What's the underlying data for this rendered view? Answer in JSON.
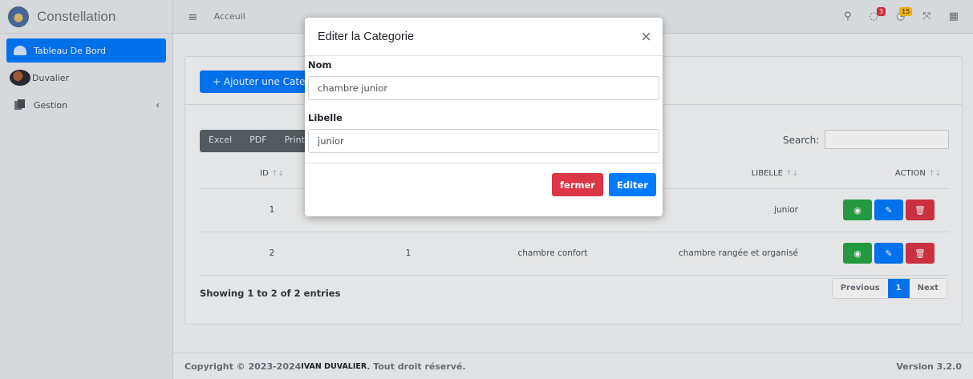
{
  "brand": {
    "name": "Constellation"
  },
  "sidebar": {
    "items": [
      {
        "label": "Tableau De Bord"
      },
      {
        "label": "Duvalier"
      },
      {
        "label": "Gestion"
      }
    ]
  },
  "topbar": {
    "link": "Acceuil",
    "messages_count": "3",
    "notifications_count": "15"
  },
  "content": {
    "add_button": "+ Ajouter une Categorie",
    "tools": [
      "Excel",
      "PDF",
      "Print"
    ],
    "search_label": "Search:",
    "columns": [
      "ID",
      "",
      "",
      "LIBELLE",
      "ACTION"
    ],
    "rows": [
      {
        "id": "1",
        "c2": "",
        "c3": "",
        "libelle": "junior"
      },
      {
        "id": "2",
        "c2": "1",
        "c3": "chambre confort",
        "libelle": "chambre rangée et organisé"
      }
    ],
    "showing": "Showing 1 to 2 of 2 entries",
    "pager": {
      "prev": "Previous",
      "page": "1",
      "next": "Next"
    }
  },
  "footer": {
    "copyright": "Copyright © 2023-2024 ",
    "author": "IVAN DUVALIER",
    "rights": ". Tout droit réservé.",
    "version": "Version 3.2.0"
  },
  "modal": {
    "title": "Editer la Categorie",
    "close": "×",
    "nom_label": "Nom",
    "nom_value": "chambre junior",
    "libelle_label": "Libelle",
    "libelle_value": "junior",
    "cancel": "fermer",
    "submit": "Editer"
  },
  "colors": {
    "primary": "#007bff",
    "danger": "#dc3545",
    "success": "#28a745"
  }
}
